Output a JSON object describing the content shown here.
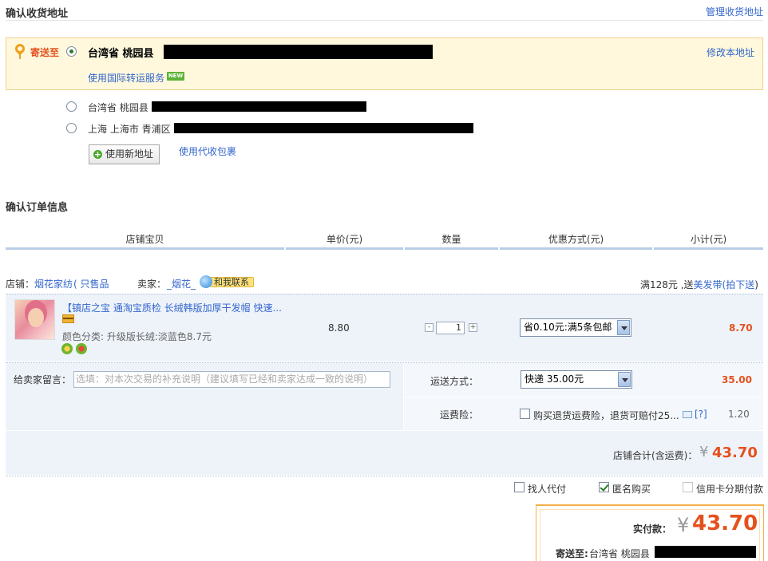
{
  "address_section": {
    "title": "确认收货地址",
    "manage_link": "管理收货地址",
    "ship_to_label": "寄送至",
    "selected_address": "台湾省 桃园县",
    "intl_forwarding": "使用国际转运服务",
    "new_badge": "NEW",
    "edit_link": "修改本地址",
    "other_addresses": [
      "台湾省 桃园县",
      "上海 上海市 青浦区"
    ],
    "use_new_address": "使用新地址",
    "use_proxy_pickup": "使用代收包裹"
  },
  "order_section": {
    "title": "确认订单信息",
    "columns": [
      "店铺宝贝",
      "单价(元)",
      "数量",
      "优惠方式(元)",
      "小计(元)"
    ]
  },
  "shop": {
    "shop_label": "店铺：",
    "shop_name": "烟花家纺",
    "shop_suffix": "( 只售品",
    "seller_label": "卖家：",
    "seller_name": "_烟花_",
    "contact": "和我联系",
    "promo_prefix": "满128元 ,送",
    "promo_link": "美发带(拍下送",
    "promo_suffix": ")"
  },
  "item": {
    "title": "【镇店之宝 通淘宝质检 长绒韩版加厚干发帽 快速...",
    "variant": "颜色分类: 升级版长绒:淡蓝色8.7元",
    "unit_price": "8.80",
    "quantity": "1",
    "discount_option": "省0.10元:满5条包邮",
    "subtotal": "8.70"
  },
  "note": {
    "label": "给卖家留言：",
    "placeholder": "选填：对本次交易的补充说明（建议填写已经和卖家达成一致的说明）"
  },
  "shipping": {
    "label": "运送方式：",
    "option": "快递 35.00元",
    "price": "35.00"
  },
  "insurance": {
    "label": "运费险：",
    "text": "购买退货运费险，退货可赔付25...",
    "help": "[?]",
    "price": "1.20"
  },
  "shop_total": {
    "label": "店铺合计(含运费)：",
    "currency": "¥",
    "amount": "43.70"
  },
  "options": {
    "proxy_pay": "找人代付",
    "anonymous": "匿名购买",
    "installment": "信用卡分期付款",
    "anonymous_checked": true
  },
  "payment": {
    "label": "实付款：",
    "currency": "¥",
    "amount": "43.70",
    "ship_to_label": "寄送至:",
    "ship_to": "台湾省 桃园县"
  },
  "colors": {
    "accent_orange": "#e5511d",
    "link_blue": "#3366cc",
    "address_bg": "#fff8dd",
    "row_bg": "#eef3fa"
  }
}
